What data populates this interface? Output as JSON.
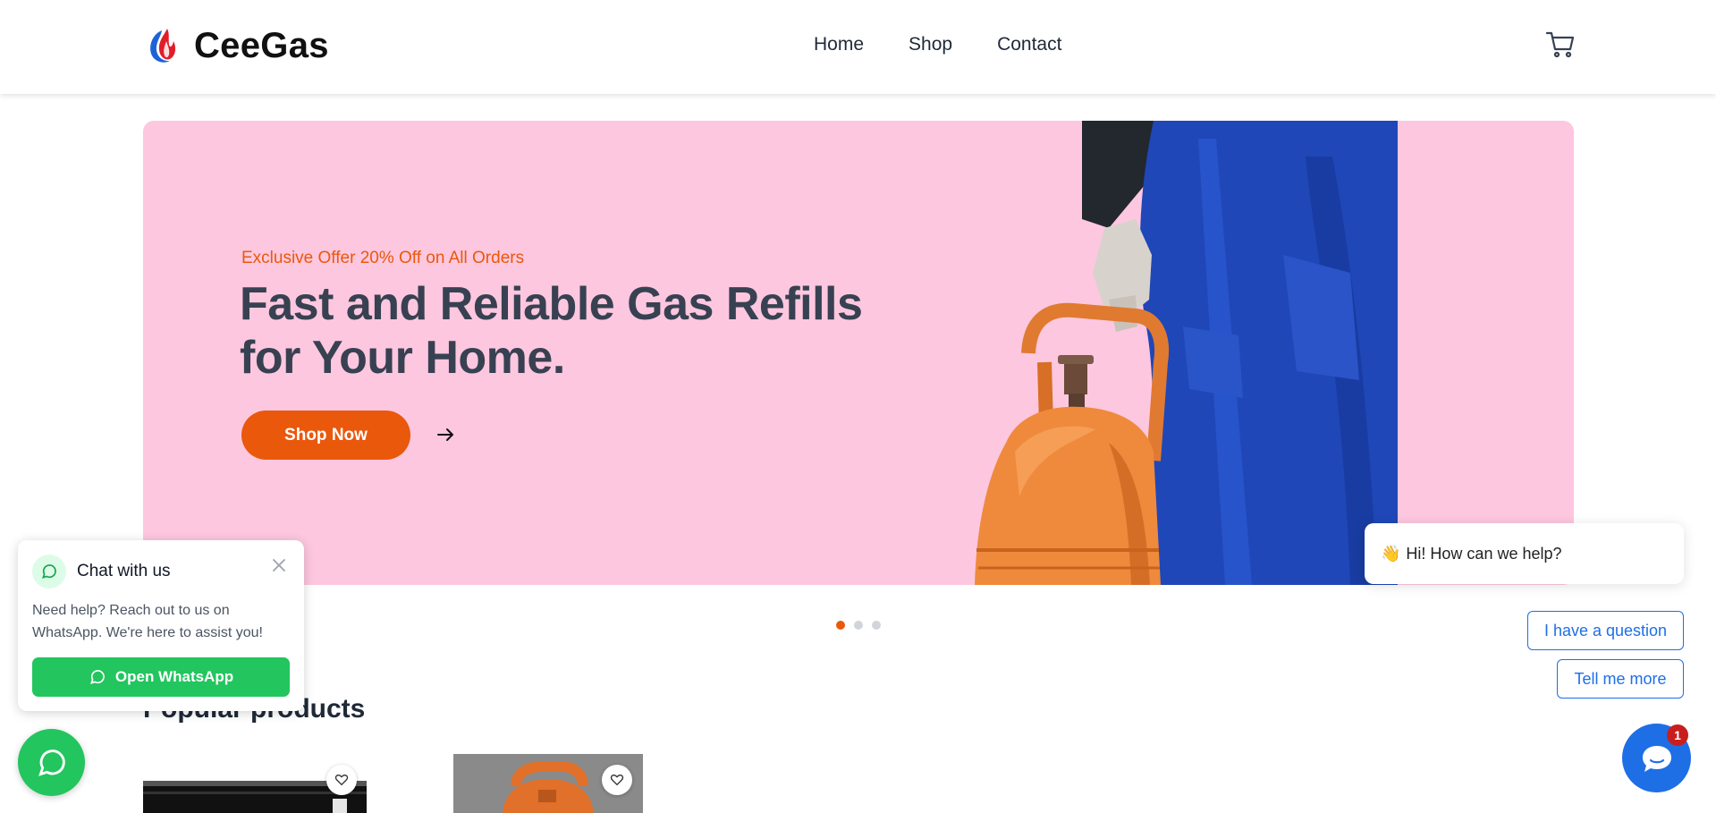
{
  "header": {
    "brand": "CeeGas",
    "nav": [
      {
        "label": "Home"
      },
      {
        "label": "Shop"
      },
      {
        "label": "Contact"
      }
    ],
    "cart_icon": "cart-icon"
  },
  "hero": {
    "offer": "Exclusive Offer 20% Off on All Orders",
    "title": "Fast and Reliable Gas Refills for Your Home.",
    "cta_label": "Shop Now",
    "background_color": "#fdc7df",
    "accent_color": "#ea580c",
    "slides_total": 3,
    "active_slide": 1
  },
  "products": {
    "section_title": "Popular products"
  },
  "chat_popup": {
    "title": "Chat with us",
    "message": "Need help? Reach out to us on WhatsApp. We're here to assist you!",
    "button_label": "Open WhatsApp",
    "color": "#22c55e"
  },
  "chatbot": {
    "greeting_emoji": "👋",
    "greeting": "Hi! How can we help?",
    "quick_replies": [
      "I have a question",
      "Tell me more"
    ],
    "unread_count": "1",
    "color": "#1e6fe6"
  }
}
